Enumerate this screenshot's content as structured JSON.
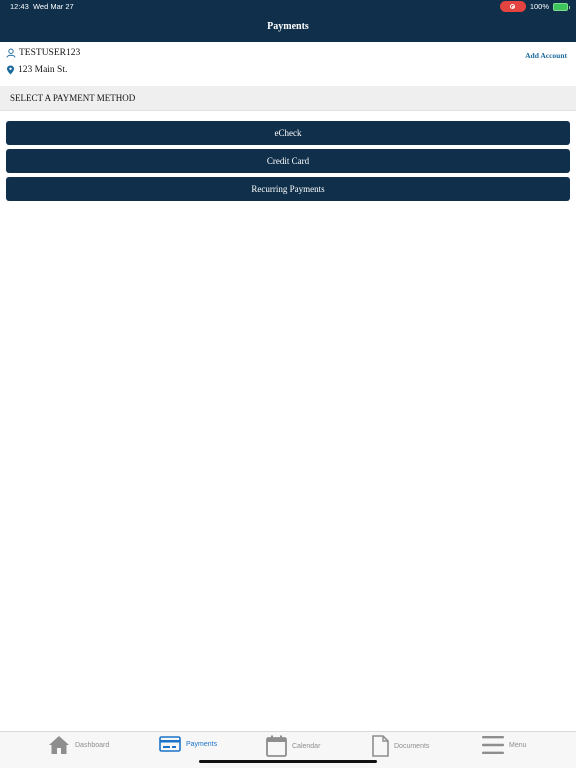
{
  "status_bar": {
    "time": "12:43",
    "date": "Wed Mar 27",
    "battery": "100%"
  },
  "header": {
    "title": "Payments"
  },
  "account": {
    "user": "TESTUSER123",
    "address": "123 Main St.",
    "add_account_label": "Add Account"
  },
  "section": {
    "title": "SELECT A PAYMENT METHOD"
  },
  "payment_methods": [
    {
      "label": "eCheck"
    },
    {
      "label": "Credit Card"
    },
    {
      "label": "Recurring Payments"
    }
  ],
  "tabs": [
    {
      "label": "Dashboard",
      "icon": "home-icon"
    },
    {
      "label": "Payments",
      "icon": "credit-card-icon",
      "active": true
    },
    {
      "label": "Calendar",
      "icon": "calendar-icon"
    },
    {
      "label": "Documents",
      "icon": "document-icon"
    },
    {
      "label": "Menu",
      "icon": "menu-icon"
    }
  ],
  "colors": {
    "primary": "#0f2f4b",
    "accent": "#1a73c9",
    "link": "#1b6a9c",
    "recording": "#e5433f",
    "battery": "#3dc45a"
  }
}
